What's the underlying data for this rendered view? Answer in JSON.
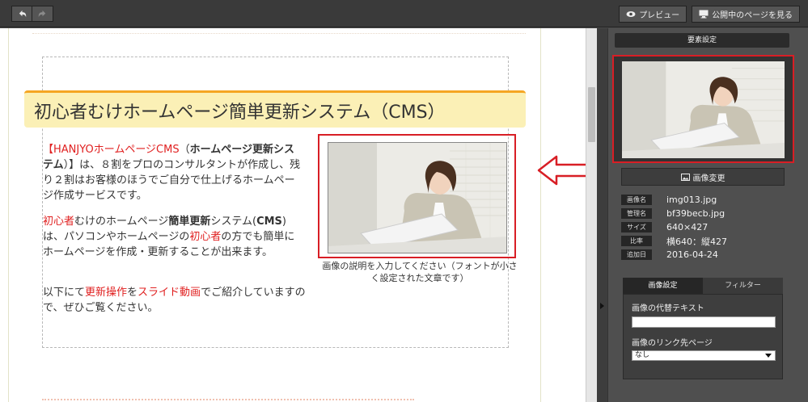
{
  "toolbar": {
    "undo_icon": "undo-icon",
    "redo_icon": "redo-icon",
    "preview_label": "プレビュー",
    "preview_icon": "eye-icon",
    "view_published_label": "公開中のページを見る",
    "view_published_icon": "monitor-icon"
  },
  "editor": {
    "heading": "初心者むけホームページ簡単更新システム（CMS）",
    "para1": {
      "bracket_open": "【",
      "brand": "HANJYOホームページCMS",
      "paren_open": "（",
      "bold": "ホームページ更新システム",
      "rest": "）】は、８割をプロのコンサルタントが作成し、残り２割はお客様のほうでご自分で仕上げるホームページ作成サービスです。"
    },
    "para2": {
      "beginner": "初心者",
      "t1": "むけのホームページ",
      "bold1": "簡単更新",
      "t2": "システム(",
      "cms": "CMS",
      "t3": ")は、パソコンやホームページの",
      "beginner2": "初心者",
      "t4": "の方でも簡単にホームページを作成・更新することが出来ます。"
    },
    "para3": {
      "t1": "以下にて",
      "op": "更新操作",
      "t2": "を",
      "video": "スライド動画",
      "t3": "でご紹介していますので、ぜひご覧ください。"
    },
    "image_caption": "画像の説明を入力してください（フォントが小さく設定された文章です）"
  },
  "panel": {
    "title": "要素設定",
    "change_image_label": "画像変更",
    "change_image_icon": "image-icon",
    "info": [
      {
        "key": "画像名",
        "value": "img013.jpg"
      },
      {
        "key": "管理名",
        "value": "bf39becb.jpg"
      },
      {
        "key": "サイズ",
        "value": "640×427"
      },
      {
        "key": "比率",
        "value": "横640：縦427"
      },
      {
        "key": "追加日",
        "value": "2016-04-24"
      }
    ],
    "tabs": {
      "image_settings": "画像設定",
      "filter": "フィルター"
    },
    "alt_text_label": "画像の代替テキスト",
    "alt_text_value": "",
    "link_label": "画像のリンク先ページ",
    "link_value": "なし"
  },
  "colors": {
    "accent_red": "#d81e25",
    "heading_bg": "#fbf0b6",
    "heading_border": "#f5a623",
    "panel_bg": "#4f4f4f"
  }
}
